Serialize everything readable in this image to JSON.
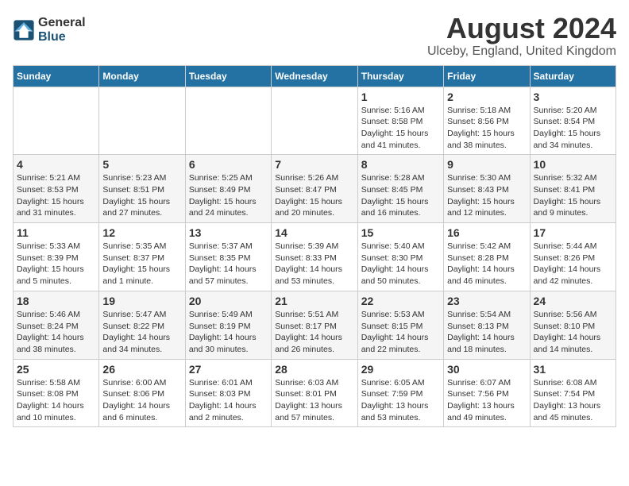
{
  "header": {
    "logo_general": "General",
    "logo_blue": "Blue",
    "main_title": "August 2024",
    "subtitle": "Ulceby, England, United Kingdom"
  },
  "weekdays": [
    "Sunday",
    "Monday",
    "Tuesday",
    "Wednesday",
    "Thursday",
    "Friday",
    "Saturday"
  ],
  "weeks": [
    [
      {
        "day": "",
        "info": ""
      },
      {
        "day": "",
        "info": ""
      },
      {
        "day": "",
        "info": ""
      },
      {
        "day": "",
        "info": ""
      },
      {
        "day": "1",
        "info": "Sunrise: 5:16 AM\nSunset: 8:58 PM\nDaylight: 15 hours\nand 41 minutes."
      },
      {
        "day": "2",
        "info": "Sunrise: 5:18 AM\nSunset: 8:56 PM\nDaylight: 15 hours\nand 38 minutes."
      },
      {
        "day": "3",
        "info": "Sunrise: 5:20 AM\nSunset: 8:54 PM\nDaylight: 15 hours\nand 34 minutes."
      }
    ],
    [
      {
        "day": "4",
        "info": "Sunrise: 5:21 AM\nSunset: 8:53 PM\nDaylight: 15 hours\nand 31 minutes."
      },
      {
        "day": "5",
        "info": "Sunrise: 5:23 AM\nSunset: 8:51 PM\nDaylight: 15 hours\nand 27 minutes."
      },
      {
        "day": "6",
        "info": "Sunrise: 5:25 AM\nSunset: 8:49 PM\nDaylight: 15 hours\nand 24 minutes."
      },
      {
        "day": "7",
        "info": "Sunrise: 5:26 AM\nSunset: 8:47 PM\nDaylight: 15 hours\nand 20 minutes."
      },
      {
        "day": "8",
        "info": "Sunrise: 5:28 AM\nSunset: 8:45 PM\nDaylight: 15 hours\nand 16 minutes."
      },
      {
        "day": "9",
        "info": "Sunrise: 5:30 AM\nSunset: 8:43 PM\nDaylight: 15 hours\nand 12 minutes."
      },
      {
        "day": "10",
        "info": "Sunrise: 5:32 AM\nSunset: 8:41 PM\nDaylight: 15 hours\nand 9 minutes."
      }
    ],
    [
      {
        "day": "11",
        "info": "Sunrise: 5:33 AM\nSunset: 8:39 PM\nDaylight: 15 hours\nand 5 minutes."
      },
      {
        "day": "12",
        "info": "Sunrise: 5:35 AM\nSunset: 8:37 PM\nDaylight: 15 hours\nand 1 minute."
      },
      {
        "day": "13",
        "info": "Sunrise: 5:37 AM\nSunset: 8:35 PM\nDaylight: 14 hours\nand 57 minutes."
      },
      {
        "day": "14",
        "info": "Sunrise: 5:39 AM\nSunset: 8:33 PM\nDaylight: 14 hours\nand 53 minutes."
      },
      {
        "day": "15",
        "info": "Sunrise: 5:40 AM\nSunset: 8:30 PM\nDaylight: 14 hours\nand 50 minutes."
      },
      {
        "day": "16",
        "info": "Sunrise: 5:42 AM\nSunset: 8:28 PM\nDaylight: 14 hours\nand 46 minutes."
      },
      {
        "day": "17",
        "info": "Sunrise: 5:44 AM\nSunset: 8:26 PM\nDaylight: 14 hours\nand 42 minutes."
      }
    ],
    [
      {
        "day": "18",
        "info": "Sunrise: 5:46 AM\nSunset: 8:24 PM\nDaylight: 14 hours\nand 38 minutes."
      },
      {
        "day": "19",
        "info": "Sunrise: 5:47 AM\nSunset: 8:22 PM\nDaylight: 14 hours\nand 34 minutes."
      },
      {
        "day": "20",
        "info": "Sunrise: 5:49 AM\nSunset: 8:19 PM\nDaylight: 14 hours\nand 30 minutes."
      },
      {
        "day": "21",
        "info": "Sunrise: 5:51 AM\nSunset: 8:17 PM\nDaylight: 14 hours\nand 26 minutes."
      },
      {
        "day": "22",
        "info": "Sunrise: 5:53 AM\nSunset: 8:15 PM\nDaylight: 14 hours\nand 22 minutes."
      },
      {
        "day": "23",
        "info": "Sunrise: 5:54 AM\nSunset: 8:13 PM\nDaylight: 14 hours\nand 18 minutes."
      },
      {
        "day": "24",
        "info": "Sunrise: 5:56 AM\nSunset: 8:10 PM\nDaylight: 14 hours\nand 14 minutes."
      }
    ],
    [
      {
        "day": "25",
        "info": "Sunrise: 5:58 AM\nSunset: 8:08 PM\nDaylight: 14 hours\nand 10 minutes."
      },
      {
        "day": "26",
        "info": "Sunrise: 6:00 AM\nSunset: 8:06 PM\nDaylight: 14 hours\nand 6 minutes."
      },
      {
        "day": "27",
        "info": "Sunrise: 6:01 AM\nSunset: 8:03 PM\nDaylight: 14 hours\nand 2 minutes."
      },
      {
        "day": "28",
        "info": "Sunrise: 6:03 AM\nSunset: 8:01 PM\nDaylight: 13 hours\nand 57 minutes."
      },
      {
        "day": "29",
        "info": "Sunrise: 6:05 AM\nSunset: 7:59 PM\nDaylight: 13 hours\nand 53 minutes."
      },
      {
        "day": "30",
        "info": "Sunrise: 6:07 AM\nSunset: 7:56 PM\nDaylight: 13 hours\nand 49 minutes."
      },
      {
        "day": "31",
        "info": "Sunrise: 6:08 AM\nSunset: 7:54 PM\nDaylight: 13 hours\nand 45 minutes."
      }
    ]
  ]
}
